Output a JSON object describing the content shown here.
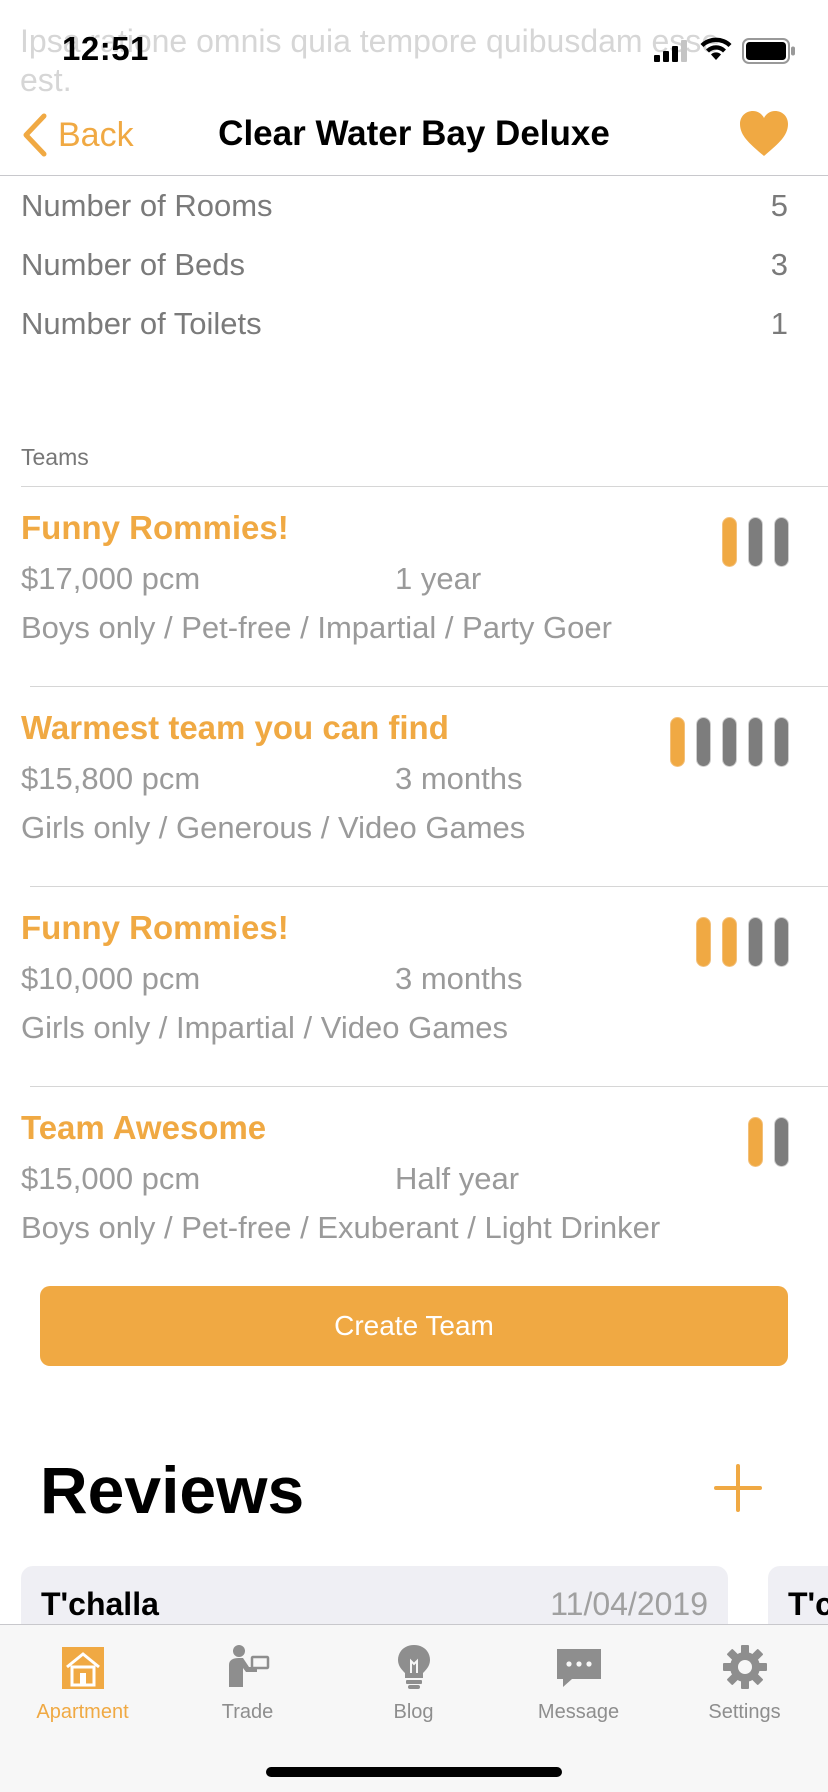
{
  "status_bar": {
    "time": "12:51"
  },
  "ghost_text": "Ipsa ratione omnis quia tempore quibusdam esse est.",
  "nav": {
    "back_label": "Back",
    "title": "Clear Water Bay Deluxe"
  },
  "stats": [
    {
      "label": "Number of Rooms",
      "value": "5"
    },
    {
      "label": "Number of Beds",
      "value": "3"
    },
    {
      "label": "Number of Toilets",
      "value": "1"
    }
  ],
  "teams_header": "Teams",
  "teams": [
    {
      "name": "Funny Rommies!",
      "price": "$17,000 pcm",
      "duration": "1 year",
      "tags": "Boys only / Pet-free / Impartial / Party Goer",
      "capacity_filled": 1,
      "capacity_total": 3
    },
    {
      "name": "Warmest team you can find",
      "price": "$15,800 pcm",
      "duration": "3 months",
      "tags": "Girls only / Generous / Video Games",
      "capacity_filled": 1,
      "capacity_total": 5
    },
    {
      "name": "Funny Rommies!",
      "price": "$10,000 pcm",
      "duration": "3 months",
      "tags": "Girls only / Impartial / Video Games",
      "capacity_filled": 2,
      "capacity_total": 4
    },
    {
      "name": "Team Awesome",
      "price": "$15,000 pcm",
      "duration": "Half year",
      "tags": "Boys only / Pet-free / Exuberant / Light Drinker",
      "capacity_filled": 1,
      "capacity_total": 2
    }
  ],
  "create_team_label": "Create Team",
  "reviews": {
    "title": "Reviews",
    "items": [
      {
        "name": "T'challa",
        "date": "11/04/2019"
      },
      {
        "name": "T'c",
        "date": ""
      }
    ]
  },
  "tabs": [
    {
      "label": "Apartment",
      "icon": "apartment-icon",
      "active": true
    },
    {
      "label": "Trade",
      "icon": "trade-icon",
      "active": false
    },
    {
      "label": "Blog",
      "icon": "lightbulb-icon",
      "active": false
    },
    {
      "label": "Message",
      "icon": "message-icon",
      "active": false
    },
    {
      "label": "Settings",
      "icon": "gear-icon",
      "active": false
    }
  ],
  "colors": {
    "accent": "#f0a943",
    "inactive_gray": "#8e8e8e",
    "pill_gray": "#7d7d7d"
  }
}
